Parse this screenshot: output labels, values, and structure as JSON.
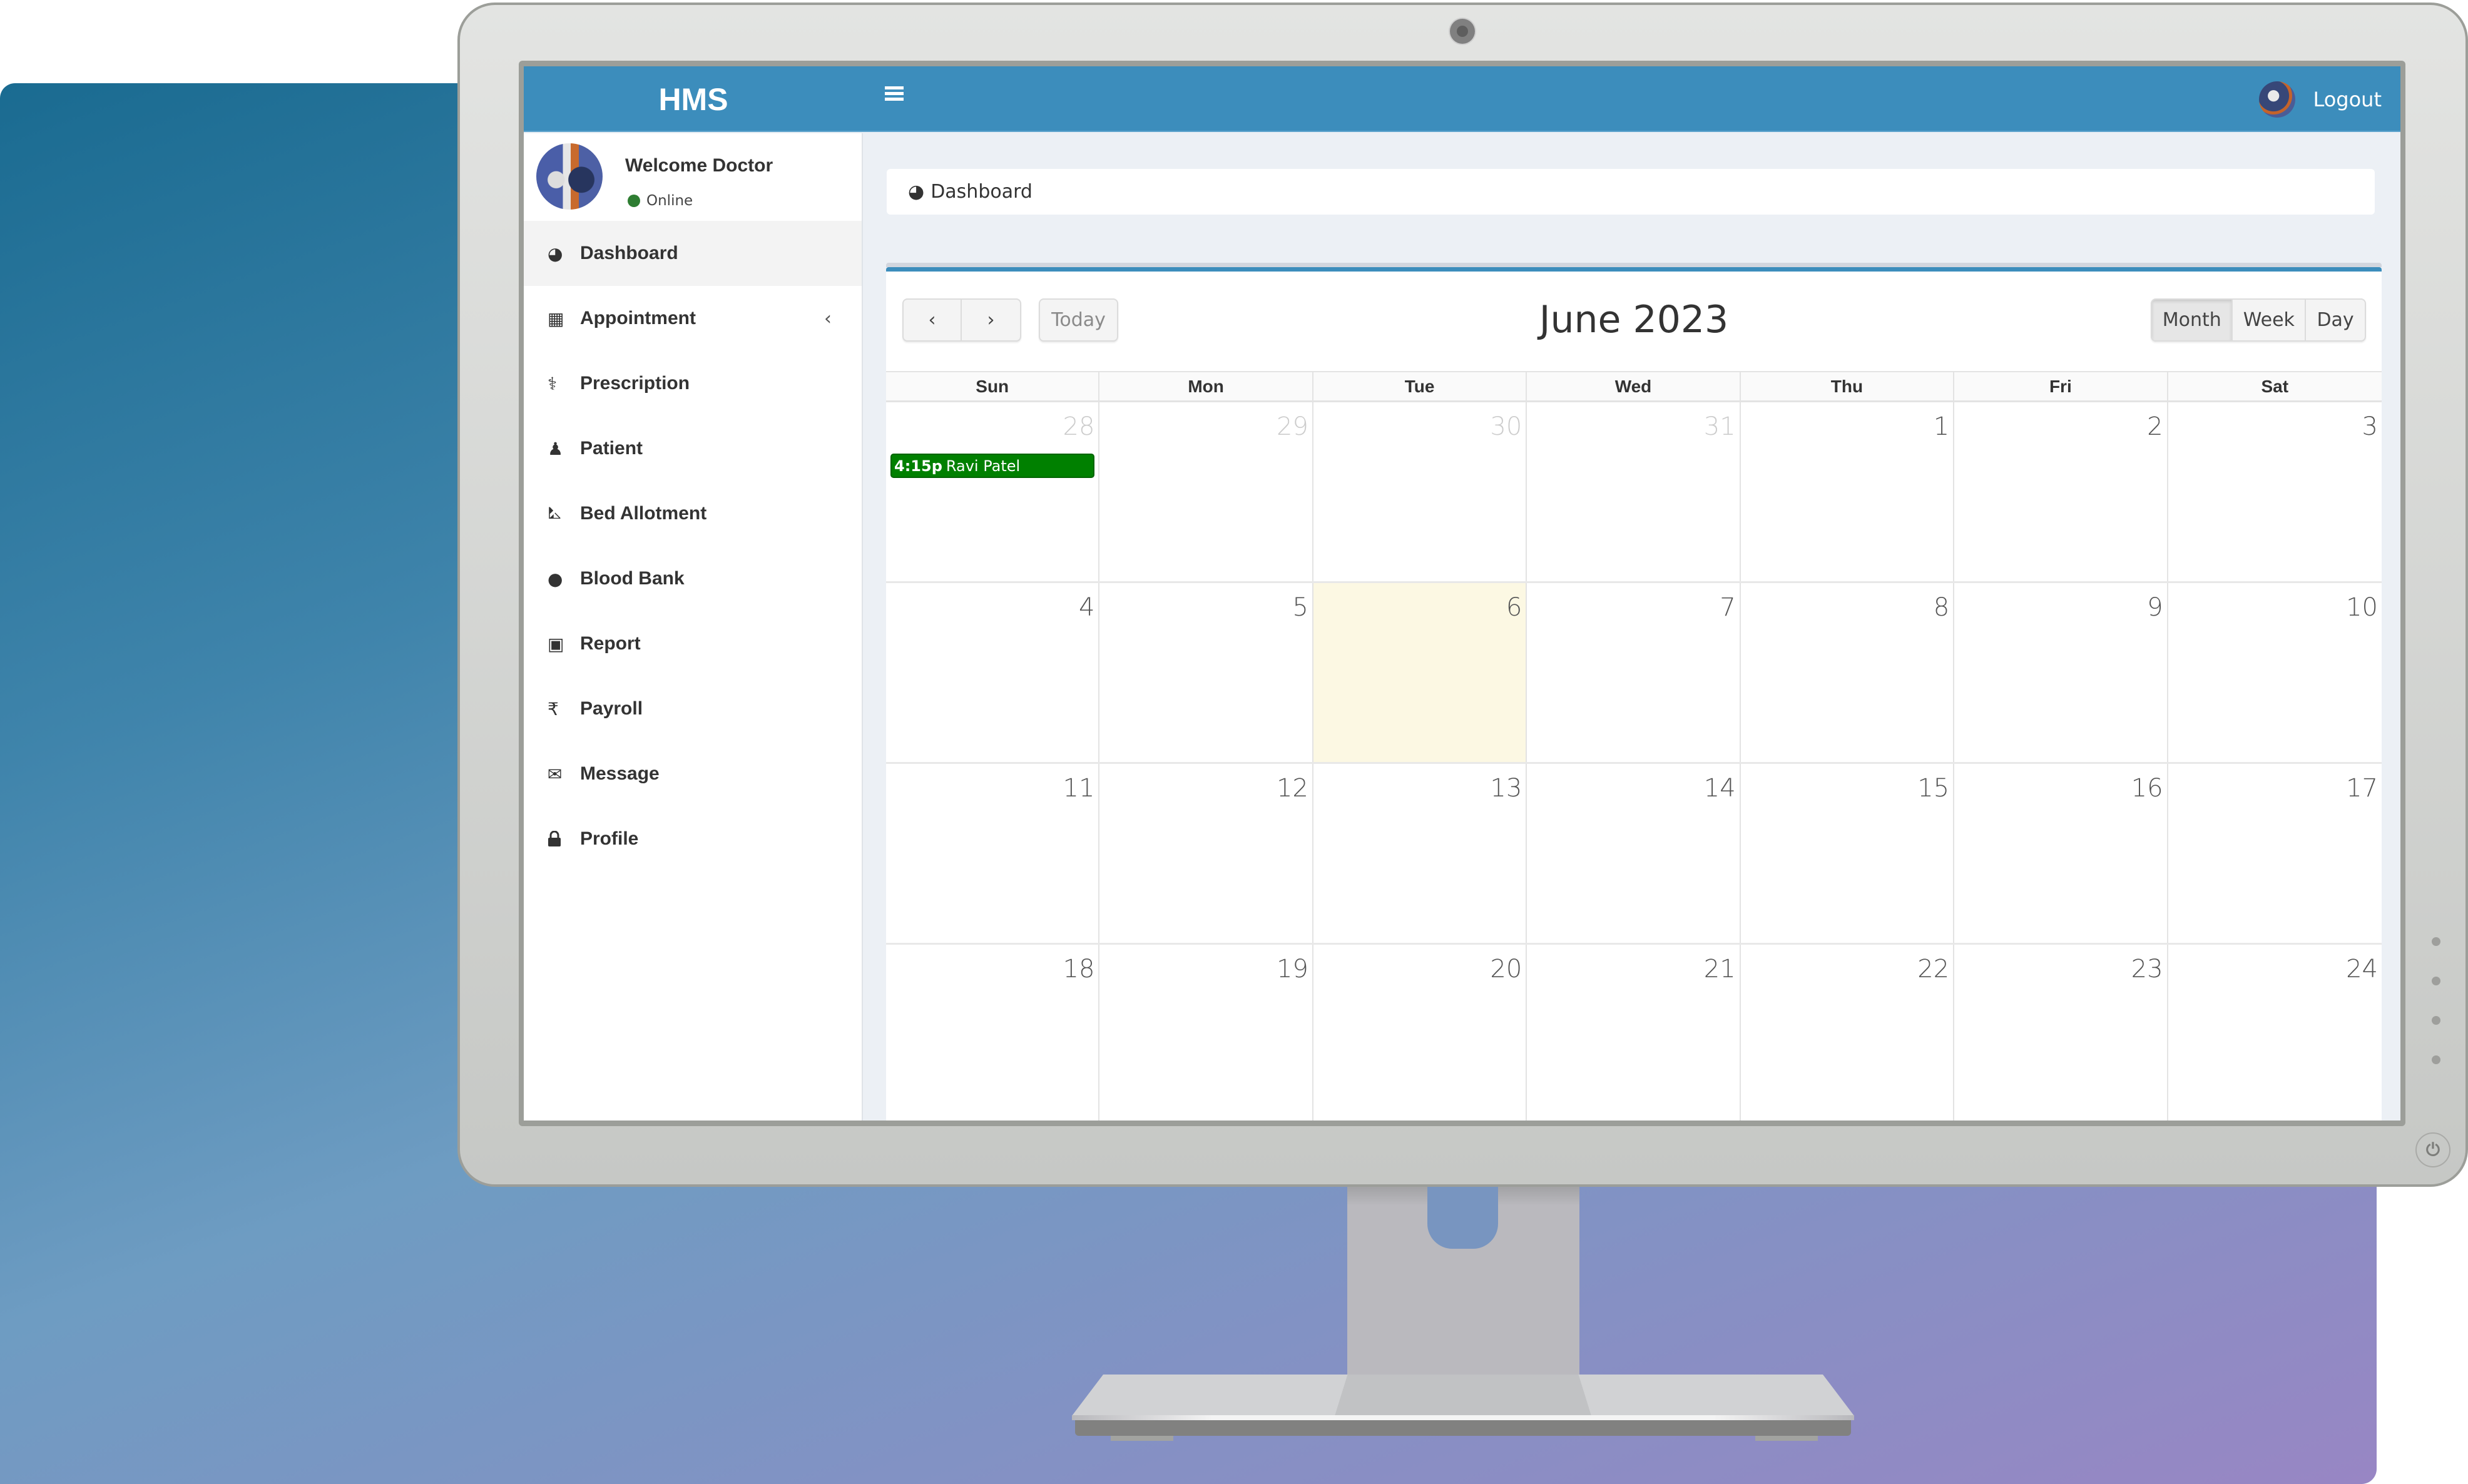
{
  "app": {
    "logo": "HMS",
    "logout_label": "Logout"
  },
  "user": {
    "welcome": "Welcome Doctor",
    "status": "Online",
    "status_color": "#2e7d32"
  },
  "sidebar": {
    "items": [
      {
        "label": "Dashboard",
        "icon": "dashboard-icon",
        "glyph": "◕",
        "active": true
      },
      {
        "label": "Appointment",
        "icon": "calendar-icon",
        "glyph": "▦",
        "has_submenu": true,
        "caret": "‹"
      },
      {
        "label": "Prescription",
        "icon": "stethoscope-icon",
        "glyph": "⚕"
      },
      {
        "label": "Patient",
        "icon": "user-icon",
        "glyph": "♟"
      },
      {
        "label": "Bed Allotment",
        "icon": "bed-icon",
        "glyph": "⛡"
      },
      {
        "label": "Blood Bank",
        "icon": "blood-drop-icon",
        "glyph": "●"
      },
      {
        "label": "Report",
        "icon": "hospital-icon",
        "glyph": "▣"
      },
      {
        "label": "Payroll",
        "icon": "rupee-icon",
        "glyph": "₹"
      },
      {
        "label": "Message",
        "icon": "envelope-icon",
        "glyph": "✉"
      },
      {
        "label": "Profile",
        "icon": "lock-icon",
        "glyph": "🔒"
      }
    ]
  },
  "breadcrumb": {
    "label": "Dashboard",
    "icon": "dashboard-icon"
  },
  "calendar": {
    "title": "June 2023",
    "prev_label": "‹",
    "next_label": "›",
    "today_label": "Today",
    "views": [
      {
        "label": "Month",
        "active": true
      },
      {
        "label": "Week",
        "active": false
      },
      {
        "label": "Day",
        "active": false
      }
    ],
    "weekdays": [
      "Sun",
      "Mon",
      "Tue",
      "Wed",
      "Thu",
      "Fri",
      "Sat"
    ],
    "weeks": [
      [
        {
          "d": "28",
          "other": true
        },
        {
          "d": "29",
          "other": true
        },
        {
          "d": "30",
          "other": true
        },
        {
          "d": "31",
          "other": true
        },
        {
          "d": "1"
        },
        {
          "d": "2"
        },
        {
          "d": "3"
        }
      ],
      [
        {
          "d": "4"
        },
        {
          "d": "5"
        },
        {
          "d": "6",
          "today": true
        },
        {
          "d": "7"
        },
        {
          "d": "8"
        },
        {
          "d": "9"
        },
        {
          "d": "10"
        }
      ],
      [
        {
          "d": "11"
        },
        {
          "d": "12"
        },
        {
          "d": "13"
        },
        {
          "d": "14"
        },
        {
          "d": "15"
        },
        {
          "d": "16"
        },
        {
          "d": "17"
        }
      ],
      [
        {
          "d": "18"
        },
        {
          "d": "19"
        },
        {
          "d": "20"
        },
        {
          "d": "21"
        },
        {
          "d": "22"
        },
        {
          "d": "23"
        },
        {
          "d": "24"
        }
      ]
    ],
    "events": [
      {
        "week": 0,
        "day": 0,
        "time": "4:15p",
        "title": "Ravi Patel",
        "color": "#008000"
      }
    ],
    "today_color": "#fcf8e3"
  },
  "colors": {
    "header": "#3c8dbc",
    "content_bg": "#ecf0f5"
  }
}
